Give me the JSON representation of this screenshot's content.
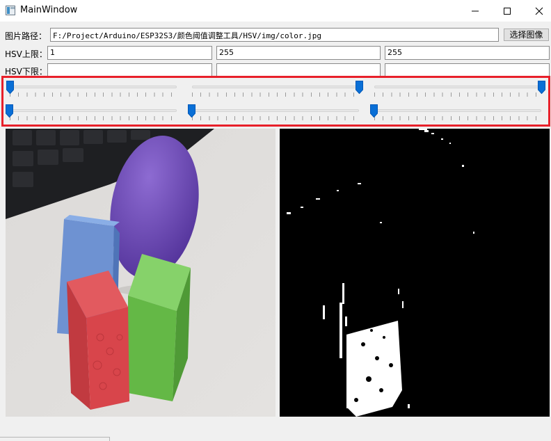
{
  "window": {
    "title": "MainWindow",
    "controls": {
      "minimize": "minimize-icon",
      "maximize": "maximize-icon",
      "close": "close-icon"
    }
  },
  "path_row": {
    "label": "图片路径：",
    "value": "F:/Project/Arduino/ESP32S3/颜色阈值调整工具/HSV/img/color.jpg",
    "button_label": "选择图像"
  },
  "hsv_upper": {
    "label": "HSV上限：",
    "values": [
      "1",
      "255",
      "255"
    ]
  },
  "hsv_lower": {
    "label": "HSV下限：",
    "values": [
      "",
      "",
      ""
    ]
  },
  "sliders": {
    "upper": [
      {
        "channel": "H",
        "value": 1,
        "max": 179
      },
      {
        "channel": "S",
        "value": 255,
        "max": 255
      },
      {
        "channel": "V",
        "value": 255,
        "max": 255
      }
    ],
    "lower": [
      {
        "channel": "H",
        "value": 0,
        "max": 179
      },
      {
        "channel": "S",
        "value": 0,
        "max": 255
      },
      {
        "channel": "V",
        "value": 0,
        "max": 255
      }
    ]
  },
  "colors": {
    "highlight_border": "#e8202a",
    "slider_handle": "#0a6fd6",
    "sphere": "#6a44b4",
    "cube_blue": "#6b8fcf",
    "cube_red": "#d9434a",
    "cube_green": "#6cc24a"
  },
  "panes": {
    "original": "color-photo",
    "mask": "binary-mask"
  }
}
